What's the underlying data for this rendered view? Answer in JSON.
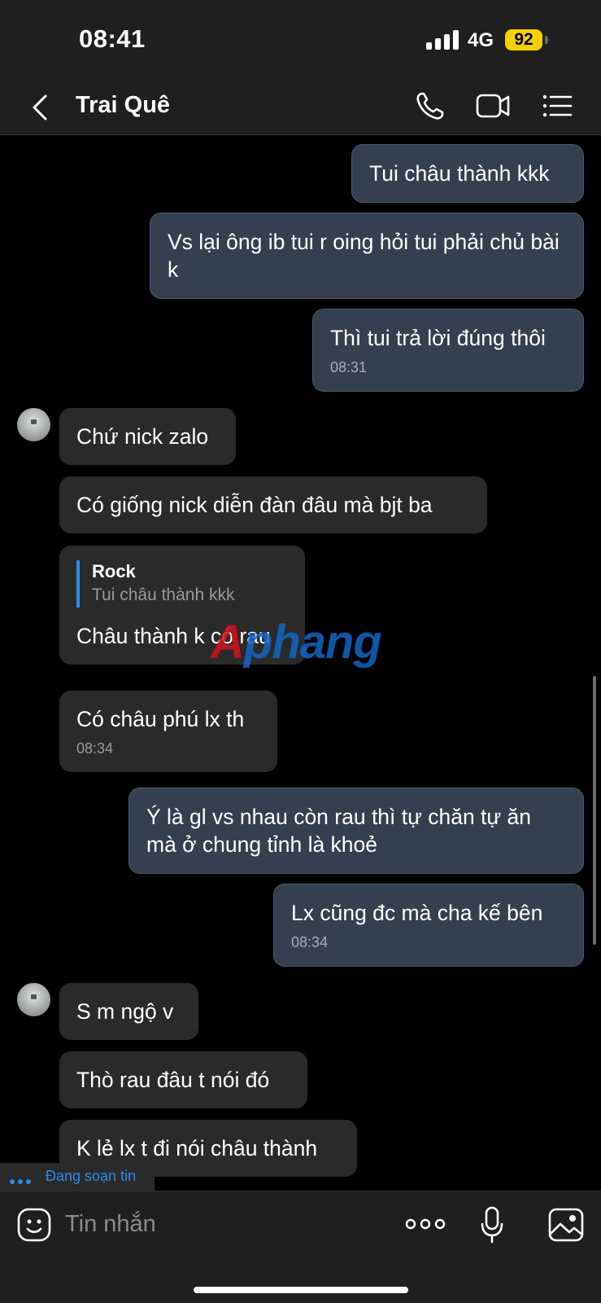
{
  "status_bar": {
    "time": "08:41",
    "network": "4G",
    "battery": "92"
  },
  "header": {
    "title": "Trai Quê"
  },
  "messages": [
    {
      "text": "Tui châu thành kkk"
    },
    {
      "text": "Vs lại ông ib tui r oing hỏi tui phải chủ bài k"
    },
    {
      "text": "Thì tui trả lời đúng thôi",
      "time": "08:31"
    },
    {
      "text": "Chứ nick zalo"
    },
    {
      "text": "Có giống nick diễn đàn đâu mà bjt ba"
    },
    {
      "quote_name": "Rock",
      "quote_text": "Tui châu thành kkk",
      "text": "Châu thành k có rau"
    },
    {
      "text": "Có châu phú lx th",
      "time": "08:34"
    },
    {
      "text": "Ý là gl vs nhau còn rau thì tự chăn tự ăn mà ở chung tỉnh là khoẻ"
    },
    {
      "text": "Lx cũng đc mà cha kế bên",
      "time": "08:34"
    },
    {
      "text": "S m ngộ v"
    },
    {
      "text": "Thò rau đâu t nói đó"
    },
    {
      "text": "K lẻ lx t đi nói châu thành"
    }
  ],
  "watermark": {
    "part1": "A",
    "part2": "phang"
  },
  "typing": {
    "text": "Đang soạn tin"
  },
  "composer": {
    "placeholder": "Tin nhắn"
  },
  "icons": [
    "chevron-left-icon",
    "phone-icon",
    "video-icon",
    "list-icon",
    "emoji-icon",
    "more-icon",
    "microphone-icon",
    "image-icon"
  ]
}
